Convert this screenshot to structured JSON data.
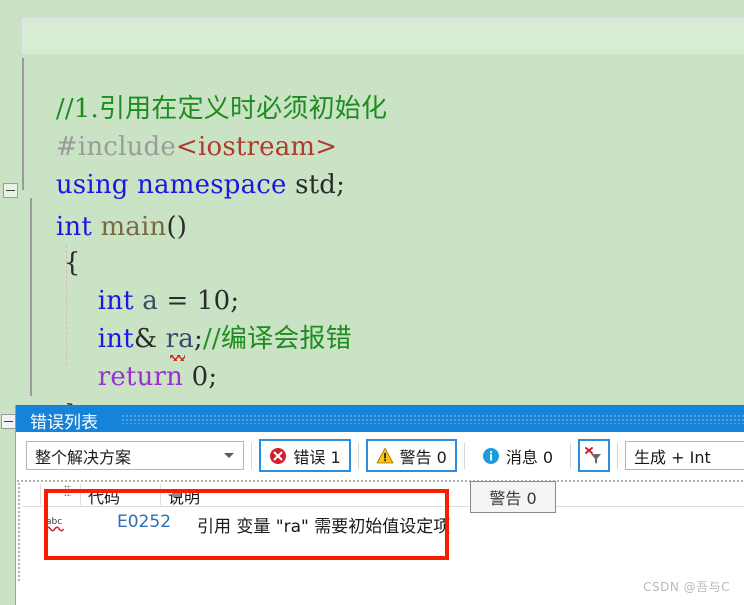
{
  "editor": {
    "lines": [
      {
        "id": "comment",
        "segments": [
          {
            "cls": "c-comment",
            "text": "//1.引用在定义时必须初始化"
          }
        ]
      },
      {
        "id": "include",
        "segments": [
          {
            "cls": "c-pp",
            "text": "#include"
          },
          {
            "cls": "c-string",
            "text": "<iostream>"
          }
        ]
      },
      {
        "id": "using",
        "segments": [
          {
            "cls": "c-kw",
            "text": "using namespace"
          },
          {
            "cls": "c-plain",
            "text": " std;"
          }
        ]
      },
      {
        "id": "main",
        "segments": [
          {
            "cls": "c-kw",
            "text": "int"
          },
          {
            "cls": "c-plain",
            "text": " "
          },
          {
            "cls": "c-func",
            "text": "main"
          },
          {
            "cls": "c-plain",
            "text": "()"
          }
        ]
      },
      {
        "id": "open-brace",
        "segments": [
          {
            "cls": "c-plain",
            "text": "{"
          }
        ]
      },
      {
        "id": "decl-a",
        "segments": [
          {
            "cls": "c-kw",
            "text": "    int"
          },
          {
            "cls": "c-var",
            "text": " a "
          },
          {
            "cls": "c-plain",
            "text": "= "
          },
          {
            "cls": "c-plain",
            "text": "10;"
          }
        ]
      },
      {
        "id": "decl-ra",
        "segments": [
          {
            "cls": "c-kw",
            "text": "    int"
          },
          {
            "cls": "c-plain",
            "text": "& "
          },
          {
            "cls": "c-var",
            "text": "ra"
          },
          {
            "cls": "c-plain",
            "text": ";"
          },
          {
            "cls": "c-comment",
            "text": "//编译会报错"
          }
        ]
      },
      {
        "id": "return",
        "segments": [
          {
            "cls": "c-ret",
            "text": "    return"
          },
          {
            "cls": "c-plain",
            "text": " 0;"
          }
        ]
      },
      {
        "id": "close-brace",
        "segments": [
          {
            "cls": "c-plain",
            "text": "}"
          }
        ]
      }
    ]
  },
  "error_panel": {
    "title": "错误列表",
    "scope_filter": {
      "value": "整个解决方案",
      "icon": "chevron-down-icon"
    },
    "toggles": [
      {
        "key": "errors",
        "icon": "error-circle-icon",
        "label": "错误 1",
        "checked": true
      },
      {
        "key": "warnings",
        "icon": "warning-triangle-icon",
        "label": "警告 0",
        "checked": true
      },
      {
        "key": "messages",
        "icon": "info-circle-icon",
        "label": "消息 0",
        "checked": false
      }
    ],
    "filter_button": {
      "icon": "clear-filter-icon"
    },
    "build_combo": {
      "value": "生成 + Int"
    },
    "grid": {
      "columns": [
        {
          "key": "code",
          "label": "代码"
        },
        {
          "key": "description",
          "label": "说明",
          "sorted": true
        }
      ],
      "rows": [
        {
          "icon": "intellisense-abc-icon",
          "code": "E0252",
          "description": "引用 变量 \"ra\" 需要初始值设定项"
        }
      ]
    },
    "tooltip": {
      "text": "警告 0"
    }
  },
  "watermark": {
    "text": "CSDN @吾与C"
  },
  "colors": {
    "panel_title_bg": "#1683d8",
    "accent_blue": "#2a8fe0",
    "error_red": "#d3202a",
    "warning_yellow": "#ffc20e",
    "info_blue": "#1e9bdc",
    "annotation_red": "#fc1c03",
    "editor_bg": "#c9e3c4",
    "code_comment": "#1e8c1e",
    "code_keyword": "#1818e0",
    "code_string": "#b03a2e",
    "code_return": "#9b2fd0"
  }
}
